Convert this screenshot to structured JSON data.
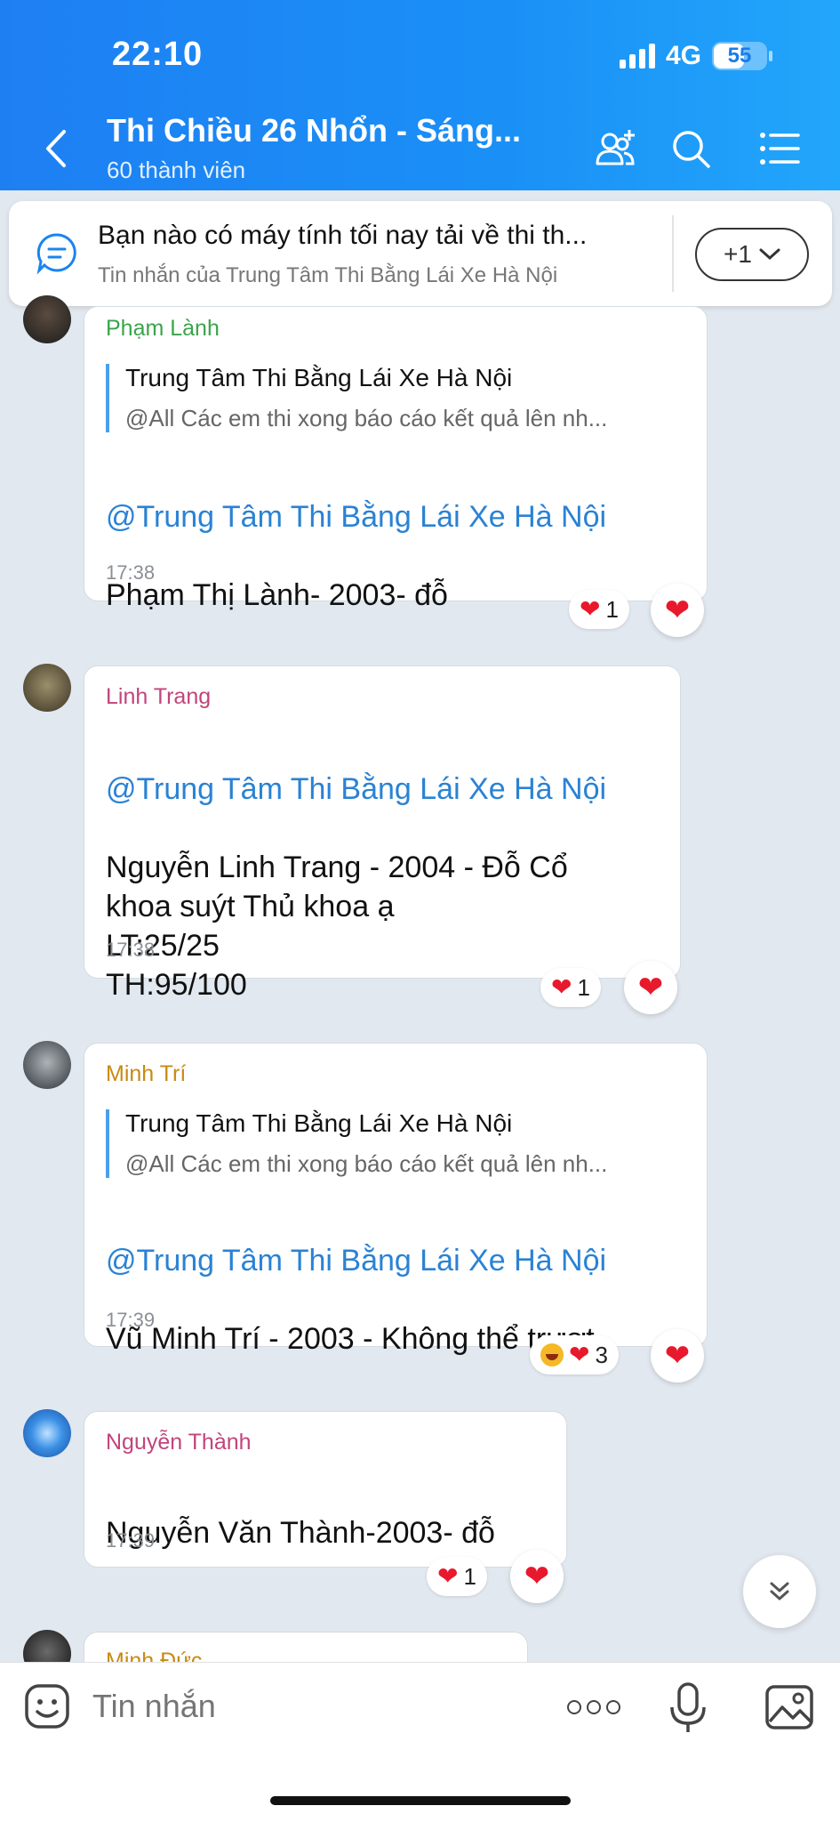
{
  "status_bar": {
    "time": "22:10",
    "network": "4G",
    "battery": "55"
  },
  "header": {
    "title": "Thi Chiều 26 Nhổn - Sáng...",
    "subtitle": "60 thành viên",
    "icons": [
      "back-icon",
      "add-member-icon",
      "search-icon",
      "menu-icon"
    ]
  },
  "pinned": {
    "text": "Bạn nào có máy tính tối nay tải về thi th...",
    "source": "Tin nhắn của Trung Tâm Thi Bằng Lái Xe Hà Nội",
    "more_label": "+1"
  },
  "messages": [
    {
      "sender": "Phạm Lành",
      "sender_color": "#3aa44a",
      "quote_title": "Trung Tâm Thi Bằng Lái Xe Hà Nội",
      "quote_text": "@All Các em thi xong báo cáo kết quả lên nh...",
      "mention": "@Trung Tâm Thi Bằng Lái Xe Hà Nội",
      "text": "Phạm Thị Lành- 2003- đỗ",
      "time": "17:38",
      "reaction_count": "1"
    },
    {
      "sender": "Linh Trang",
      "sender_color": "#c2447c",
      "mention": "@Trung Tâm Thi Bằng Lái Xe Hà Nội",
      "text": "Nguyễn Linh Trang - 2004 - Đỗ Cổ\nkhoa suýt Thủ khoa ạ\nLT:25/25\nTH:95/100",
      "time": "17:38",
      "reaction_count": "1"
    },
    {
      "sender": "Minh Trí",
      "sender_color": "#c88a12",
      "quote_title": "Trung Tâm Thi Bằng Lái Xe Hà Nội",
      "quote_text": "@All Các em thi xong báo cáo kết quả lên nh...",
      "mention": "@Trung Tâm Thi Bằng Lái Xe Hà Nội",
      "text": "Vũ Minh Trí - 2003 - Không thể trượt",
      "time": "17:39",
      "reaction_count": "3"
    },
    {
      "sender": "Nguyễn Thành",
      "sender_color": "#c2447c",
      "text": "Nguyễn Văn Thành-2003- đỗ",
      "time": "17:39",
      "reaction_count": "1"
    },
    {
      "sender": "Minh Đức",
      "sender_color": "#c88a12"
    }
  ],
  "composer": {
    "placeholder": "Tin nhắn"
  }
}
